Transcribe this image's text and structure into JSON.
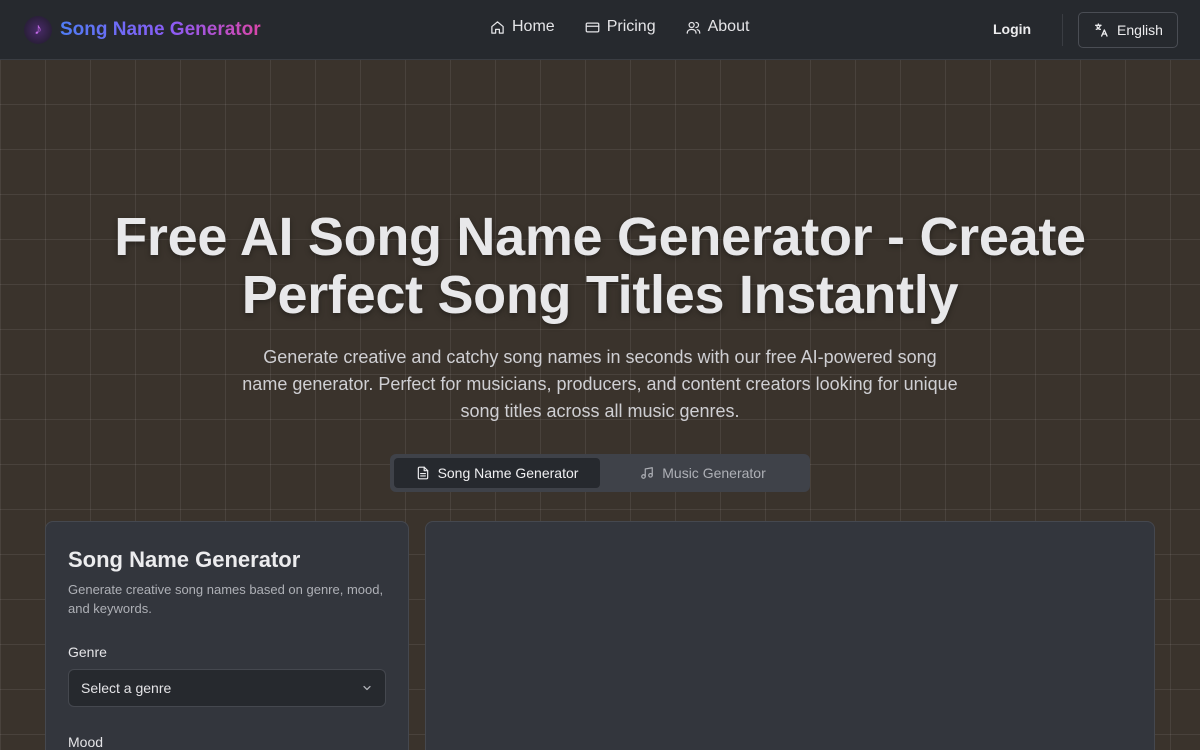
{
  "header": {
    "brand": "Song Name Generator",
    "nav": [
      {
        "label": "Home",
        "icon": "home-icon"
      },
      {
        "label": "Pricing",
        "icon": "card-icon"
      },
      {
        "label": "About",
        "icon": "users-icon"
      }
    ],
    "login": "Login",
    "language": "English"
  },
  "hero": {
    "title": "Free AI Song Name Generator - Create Perfect Song Titles Instantly",
    "subtitle": "Generate creative and catchy song names in seconds with our free AI-powered song name generator. Perfect for musicians, producers, and content creators looking for unique song titles across all music genres."
  },
  "tabs": [
    {
      "label": "Song Name Generator",
      "icon": "document-icon",
      "active": true
    },
    {
      "label": "Music Generator",
      "icon": "music-note-icon",
      "active": false
    }
  ],
  "form": {
    "title": "Song Name Generator",
    "description": "Generate creative song names based on genre, mood, and keywords.",
    "genre_label": "Genre",
    "genre_placeholder": "Select a genre",
    "mood_label": "Mood"
  },
  "colors": {
    "background": "#3a332c",
    "header_bg": "#26292e",
    "panel_bg": "#33363d",
    "brand_gradient_start": "#4f7df5",
    "brand_gradient_end": "#d946a8"
  }
}
